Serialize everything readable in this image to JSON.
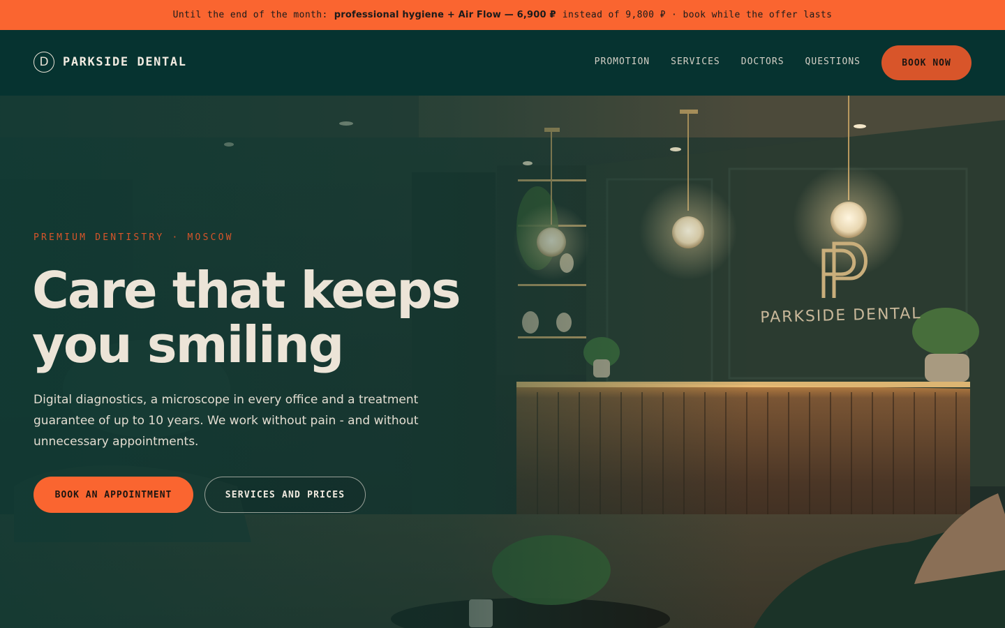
{
  "promo": {
    "prefix": "Until the end of the month:",
    "highlight": "professional hygiene + Air Flow — 6,900 ₽",
    "suffix": "instead of 9,800 ₽ · book while the offer lasts"
  },
  "header": {
    "logo_letter": "D",
    "logo_text": "PARKSIDE DENTAL",
    "nav": [
      "PROMOTION",
      "SERVICES",
      "DOCTORS",
      "QUESTIONS"
    ],
    "book_now": "BOOK NOW"
  },
  "hero": {
    "eyebrow": "PREMIUM DENTISTRY · MOSCOW",
    "headline_line1": "Care that keeps",
    "headline_line2": "you smiling",
    "lead": "Digital diagnostics, a microscope in every office and a treatment guarantee of up to 10 years. We work without pain - and without unnecessary appointments.",
    "cta_primary": "BOOK AN APPOINTMENT",
    "cta_secondary": "SERVICES AND PRICES",
    "sign_text": "PARKSIDE DENTAL"
  },
  "colors": {
    "accent": "#fa6530",
    "header_bg": "#063330",
    "text_light": "#ece4d7"
  }
}
